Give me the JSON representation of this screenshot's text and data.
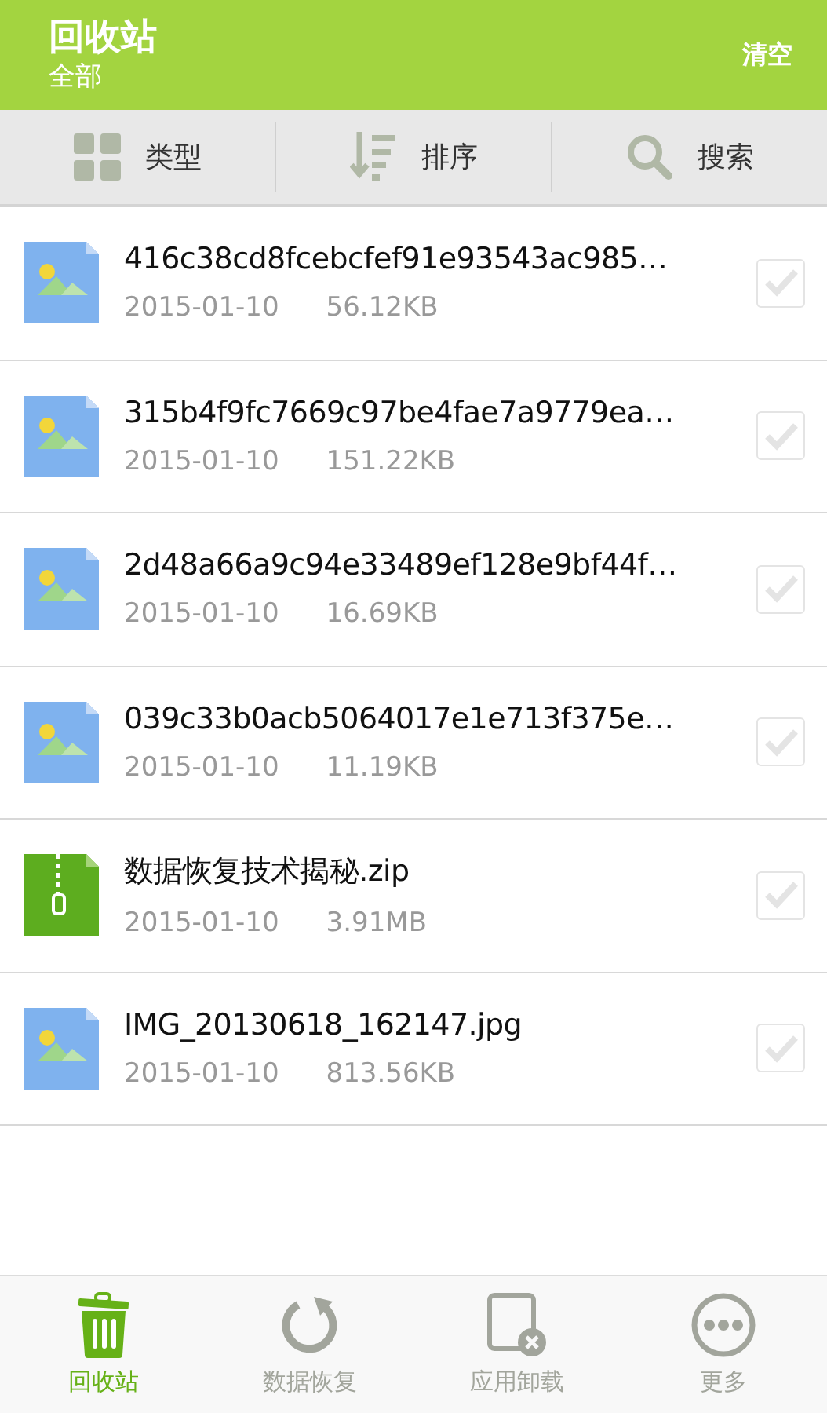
{
  "header": {
    "title": "回收站",
    "subtitle": "全部",
    "action": "清空"
  },
  "toolbar": [
    {
      "label": "类型",
      "kind": "grid"
    },
    {
      "label": "排序",
      "kind": "sort"
    },
    {
      "label": "搜索",
      "kind": "search"
    }
  ],
  "files": [
    {
      "name": "416c38cd8fcebcfef91e93543ac985…",
      "date": "2015-01-10",
      "size": "56.12KB",
      "kind": "image",
      "checked": false
    },
    {
      "name": "315b4f9fc7669c97be4fae7a9779ea…",
      "date": "2015-01-10",
      "size": "151.22KB",
      "kind": "image",
      "checked": false
    },
    {
      "name": "2d48a66a9c94e33489ef128e9bf44f…",
      "date": "2015-01-10",
      "size": "16.69KB",
      "kind": "image",
      "checked": false
    },
    {
      "name": "039c33b0acb5064017e1e713f375e…",
      "date": "2015-01-10",
      "size": "11.19KB",
      "kind": "image",
      "checked": false
    },
    {
      "name": "数据恢复技术揭秘.zip",
      "date": "2015-01-10",
      "size": "3.91MB",
      "kind": "zip",
      "checked": false
    },
    {
      "name": "IMG_20130618_162147.jpg",
      "date": "2015-01-10",
      "size": "813.56KB",
      "kind": "image",
      "checked": false
    }
  ],
  "nav": [
    {
      "label": "回收站",
      "kind": "trash",
      "selected": true
    },
    {
      "label": "数据恢复",
      "kind": "restore",
      "selected": false
    },
    {
      "label": "应用卸载",
      "kind": "uninstall",
      "selected": false
    },
    {
      "label": "更多",
      "kind": "more",
      "selected": false
    }
  ]
}
